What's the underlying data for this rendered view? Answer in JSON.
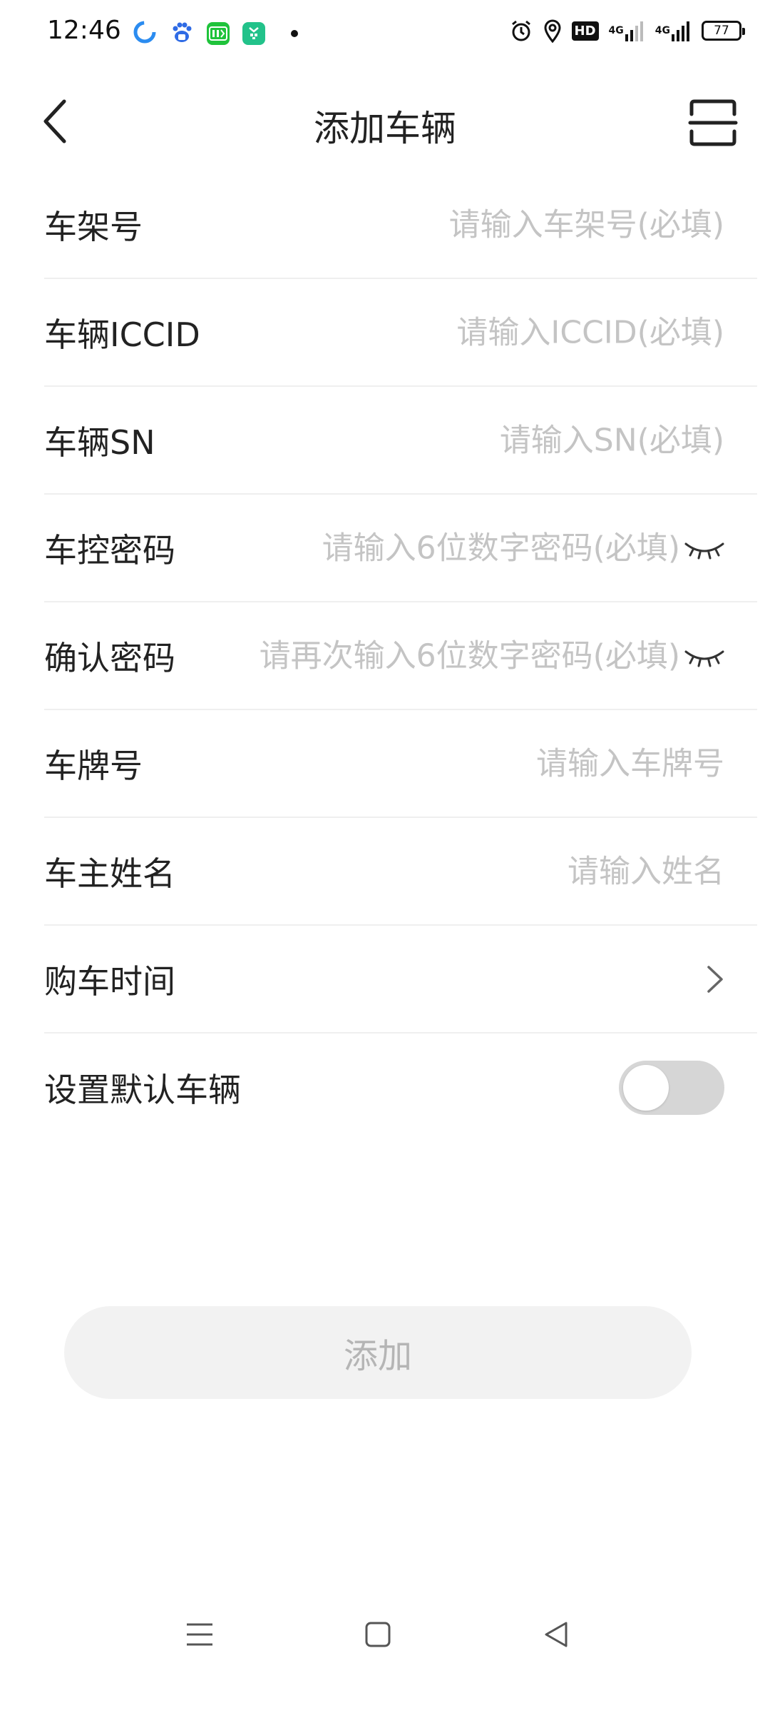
{
  "status_bar": {
    "time": "12:46",
    "app_icons": [
      "browser-icon",
      "baidu-icon",
      "iqiyi-icon",
      "shop-icon"
    ],
    "hd_badge": "HD",
    "network_1": "4G",
    "network_2": "4G",
    "battery": "77"
  },
  "header": {
    "title": "添加车辆",
    "back_icon": "back-arrow-icon",
    "scan_icon": "scan-icon"
  },
  "form": {
    "frame_number": {
      "label": "车架号",
      "placeholder": "请输入车架号(必填)"
    },
    "iccid": {
      "label": "车辆ICCID",
      "placeholder": "请输入ICCID(必填)"
    },
    "sn": {
      "label": "车辆SN",
      "placeholder": "请输入SN(必填)"
    },
    "control_password": {
      "label": "车控密码",
      "placeholder": "请输入6位数字密码(必填)"
    },
    "confirm_password": {
      "label": "确认密码",
      "placeholder": "请再次输入6位数字密码(必填)"
    },
    "plate_number": {
      "label": "车牌号",
      "placeholder": "请输入车牌号"
    },
    "owner_name": {
      "label": "车主姓名",
      "placeholder": "请输入姓名"
    },
    "purchase_time": {
      "label": "购车时间"
    },
    "default_vehicle": {
      "label": "设置默认车辆",
      "toggle_on": false
    }
  },
  "submit": {
    "label": "添加"
  },
  "colors": {
    "placeholder": "#c4c4c4",
    "divider": "#efefef",
    "toggle_off": "#d6d6d6",
    "button_disabled_bg": "#f2f2f2",
    "button_disabled_text": "#b5b5b5"
  }
}
